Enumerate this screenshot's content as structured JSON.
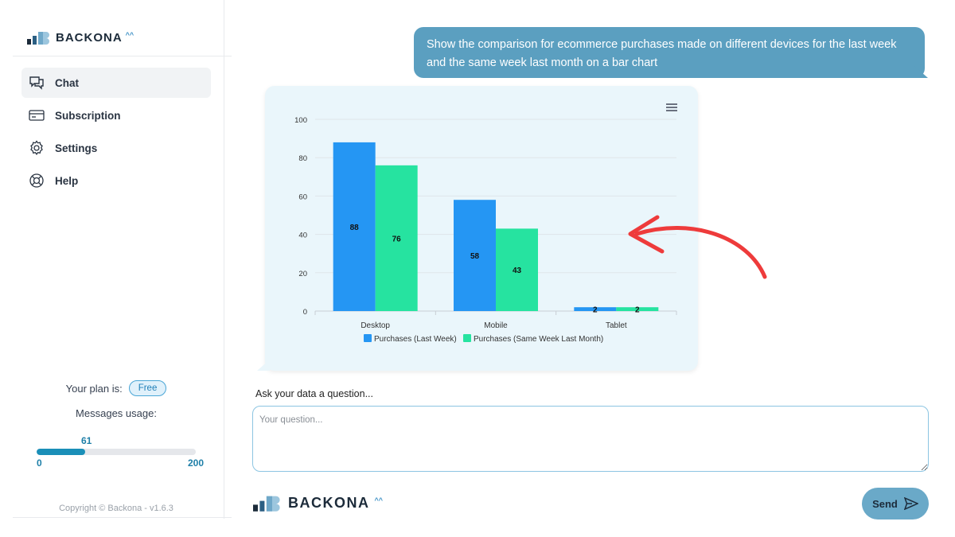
{
  "brand": {
    "name": "BACKONA",
    "mark": "^^"
  },
  "sidebar": {
    "items": [
      {
        "label": "Chat",
        "icon": "chat-icon",
        "active": true
      },
      {
        "label": "Subscription",
        "icon": "card-icon",
        "active": false
      },
      {
        "label": "Settings",
        "icon": "gear-icon",
        "active": false
      },
      {
        "label": "Help",
        "icon": "lifebuoy-icon",
        "active": false
      }
    ],
    "plan_label": "Your plan is:",
    "plan_value": "Free",
    "usage_label": "Messages usage:",
    "usage_current": "61",
    "usage_min": "0",
    "usage_max": "200",
    "usage_fraction": 0.305,
    "copyright": "Copyright © Backona - v1.6.3"
  },
  "chat": {
    "user_message": "Show the comparison for ecommerce purchases made on different devices for the last week and the same week last month on a bar chart"
  },
  "input": {
    "label": "Ask your data a question...",
    "placeholder": "Your question..."
  },
  "send_label": "Send",
  "colors": {
    "series1": "#2596f3",
    "series2": "#26e3a0",
    "bubble": "#5b9fc0",
    "arrow": "#ee3b3b"
  },
  "chart_data": {
    "type": "bar",
    "categories": [
      "Desktop",
      "Mobile",
      "Tablet"
    ],
    "series": [
      {
        "name": "Purchases (Last Week)",
        "values": [
          88,
          58,
          2
        ]
      },
      {
        "name": "Purchases (Same Week Last Month)",
        "values": [
          76,
          43,
          2
        ]
      }
    ],
    "ylim": [
      0,
      100
    ],
    "yticks": [
      0,
      20,
      40,
      60,
      80,
      100
    ],
    "grid": true,
    "legend": "bottom"
  }
}
